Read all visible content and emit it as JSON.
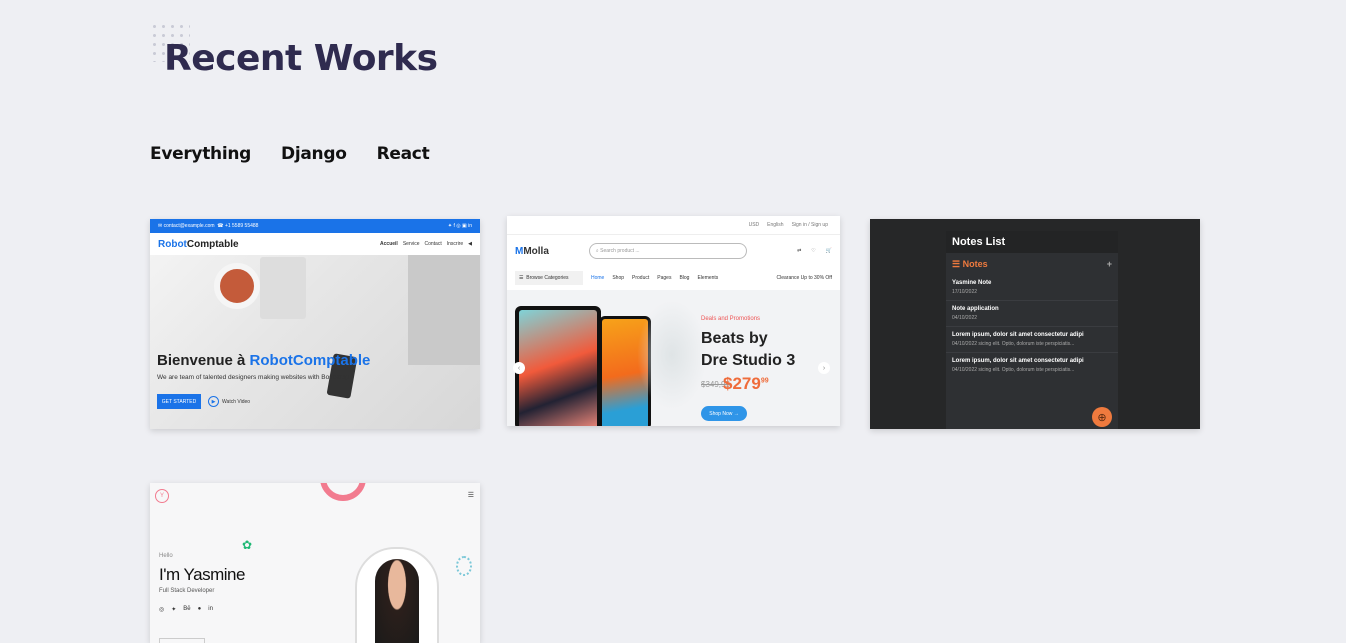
{
  "page": {
    "title": "Recent Works",
    "filters": [
      "Everything",
      "Django",
      "React"
    ]
  },
  "works": {
    "robotcomptable": {
      "topbar_email": "contact@example.com",
      "topbar_phone": "+1 5589 55488",
      "logo_blue": "Robot",
      "logo_dark": "Comptable",
      "menu": [
        "Accueil",
        "Service",
        "Contact",
        "Inscrire"
      ],
      "heading_prefix": "Bienvenue à ",
      "heading_brand": "RobotComptable",
      "subtitle": "We are team of talented designers making websites with Bootstrap",
      "cta": "GET STARTED",
      "video": "Watch Video"
    },
    "molla": {
      "top_links": [
        "USD",
        "English",
        "Sign in / Sign up"
      ],
      "logo": "Molla",
      "search_placeholder": "Search product ...",
      "header_icons": [
        "Compare",
        "Wishlist",
        "Cart"
      ],
      "browse": "Browse Categories",
      "nav": [
        "Home",
        "Shop",
        "Product",
        "Pages",
        "Blog",
        "Elements"
      ],
      "promo": "Clearance Up to 30% Off",
      "deals": "Deals and Promotions",
      "headline_1": "Beats by",
      "headline_2": "Dre Studio 3",
      "old_price": "$349,95",
      "price": "$279",
      "price_cents": "99",
      "shop_button": "Shop Now"
    },
    "notes": {
      "title": "Notes List",
      "section": "Notes",
      "items": [
        {
          "title": "Yasmine Note",
          "date": "17/10/2022"
        },
        {
          "title": "Note application",
          "date": "04/10/2022"
        },
        {
          "title": "Lorem ipsum, dolor sit amet consectetur adipi",
          "date": "04/10/2022 sicing elit. Optio, dolorum iste perspiciatis..."
        },
        {
          "title": "Lorem ipsum, dolor sit amet consectetur adipi",
          "date": "04/10/2022 sicing elit. Optio, dolorum iste perspiciatis..."
        }
      ]
    },
    "portfolio": {
      "logo": "Y",
      "hello": "Hello",
      "name": "I'm Yasmine",
      "role": "Full Stack Developer",
      "socials": [
        "◎",
        "✦",
        "Bē",
        "●",
        "in"
      ]
    }
  },
  "colors": {
    "background": "#eeeff3",
    "title": "#2f2b4f",
    "accent_blue": "#1a73e8",
    "accent_orange": "#ef7a3e"
  }
}
